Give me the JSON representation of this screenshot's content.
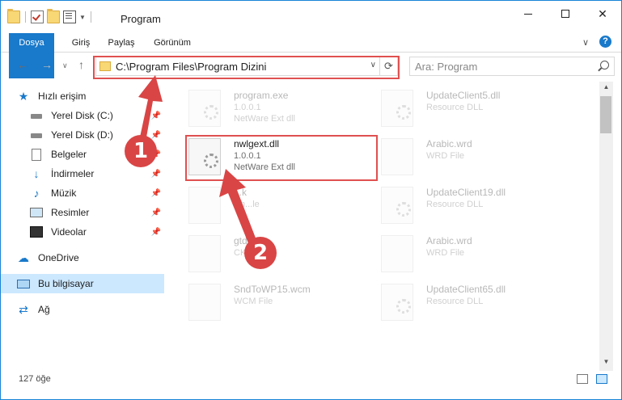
{
  "window": {
    "title": "Program"
  },
  "ribbon": {
    "tabs": [
      "Dosya",
      "Giriş",
      "Paylaş",
      "Görünüm"
    ]
  },
  "address": {
    "path": "C:\\Program Files\\Program Dizini",
    "search_placeholder": "Ara: Program"
  },
  "sidebar": {
    "items": [
      {
        "label": "Hızlı erişim",
        "icon": "star-icon"
      },
      {
        "label": "Yerel Disk (C:)",
        "icon": "disk-icon"
      },
      {
        "label": "Yerel Disk (D:)",
        "icon": "disk-icon"
      },
      {
        "label": "Belgeler",
        "icon": "documents-icon"
      },
      {
        "label": "İndirmeler",
        "icon": "download-icon"
      },
      {
        "label": "Müzik",
        "icon": "music-icon"
      },
      {
        "label": "Resimler",
        "icon": "pictures-icon"
      },
      {
        "label": "Videolar",
        "icon": "videos-icon"
      },
      {
        "label": "OneDrive",
        "icon": "cloud-icon"
      },
      {
        "label": "Bu bilgisayar",
        "icon": "computer-icon"
      },
      {
        "label": "Ağ",
        "icon": "network-icon"
      }
    ]
  },
  "files": [
    {
      "name": "program.exe",
      "line2": "1.0.0.1",
      "line3": "NetWare Ext dll"
    },
    {
      "name": "UpdateClient5.dll",
      "line2": "Resource DLL",
      "line3": ""
    },
    {
      "name": "nwlgext.dll",
      "line2": "1.0.0.1",
      "line3": "NetWare Ext dll"
    },
    {
      "name": "Arabic.wrd",
      "line2": "WRD File",
      "line3": ""
    },
    {
      "name": "...k",
      "line2": "Ch...le",
      "line3": ""
    },
    {
      "name": "UpdateClient19.dll",
      "line2": "Resource DLL",
      "line3": ""
    },
    {
      "name": "gtd.c...",
      "line2": "CK...",
      "line3": ""
    },
    {
      "name": "Arabic.wrd",
      "line2": "WRD File",
      "line3": ""
    },
    {
      "name": "SndToWP15.wcm",
      "line2": "WCM File",
      "line3": ""
    },
    {
      "name": "UpdateClient65.dll",
      "line2": "Resource DLL",
      "line3": ""
    }
  ],
  "status": {
    "count": "127 öğe"
  },
  "callouts": {
    "one": "1",
    "two": "2"
  },
  "colors": {
    "accent": "#1979ca",
    "highlight": "#e05050"
  }
}
